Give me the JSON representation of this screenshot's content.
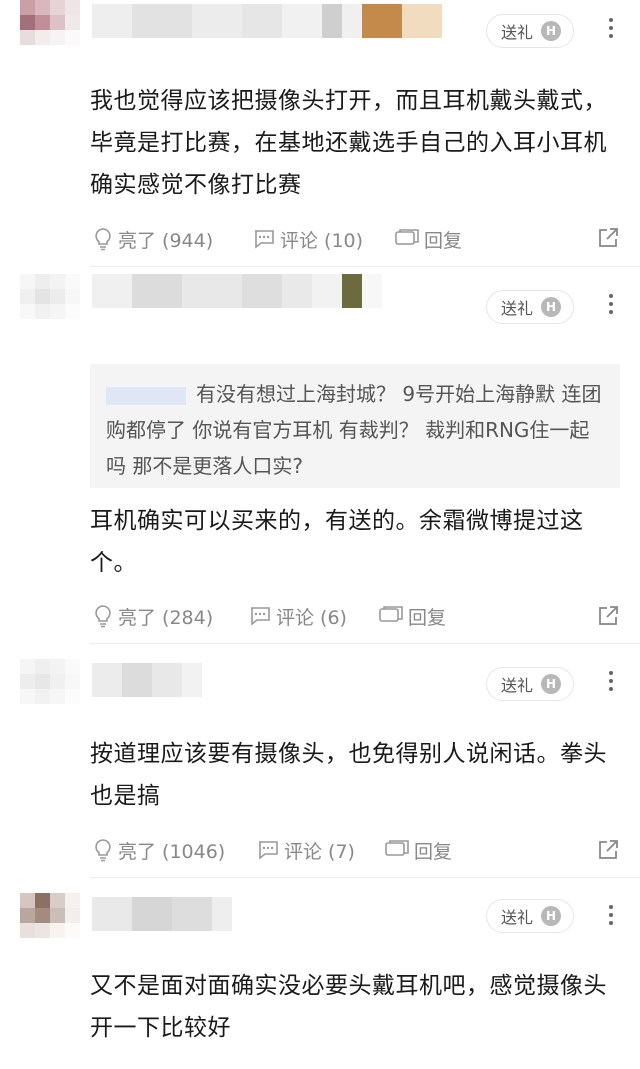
{
  "gift_label": "送礼",
  "gift_badge": "H",
  "comments": [
    {
      "text": "我也觉得应该把摄像头打开，而且耳机戴头戴式，毕竟是打比赛，在基地还戴选手自己的入耳小耳机确实感觉不像打比赛",
      "like_label": "亮了 (944)",
      "comment_label": "评论 (10)",
      "reply_label": "回复"
    },
    {
      "quote": "有没有想过上海封城？  9号开始上海静默 连团购都停了 你说有官方耳机 有裁判？ 裁判和RNG住一起吗 那不是更落人口实?",
      "text": "耳机确实可以买来的，有送的。余霜微博提过这个。",
      "like_label": "亮了 (284)",
      "comment_label": "评论 (6)",
      "reply_label": "回复"
    },
    {
      "text": "按道理应该要有摄像头，也免得别人说闲话。拳头也是搞",
      "like_label": "亮了 (1046)",
      "comment_label": "评论 (7)",
      "reply_label": "回复"
    },
    {
      "text": "又不是面对面确实没必要头戴耳机吧，感觉摄像头开一下比较好"
    }
  ]
}
